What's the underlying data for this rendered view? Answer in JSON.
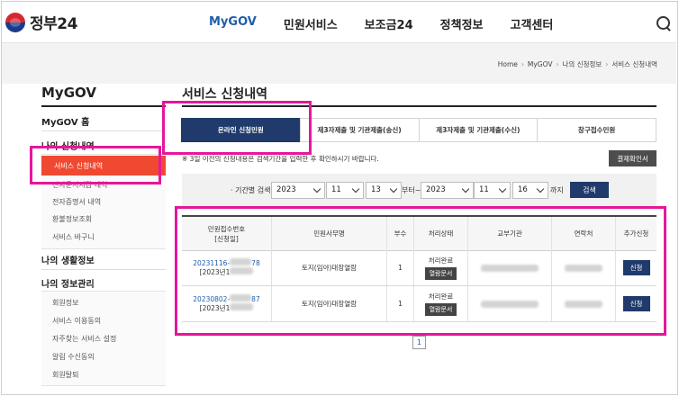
{
  "header": {
    "logo_text": "정부24",
    "nav": [
      "MyGOV",
      "민원서비스",
      "보조금24",
      "정책정보",
      "고객센터"
    ],
    "nav_active": "MyGOV"
  },
  "breadcrumb": [
    "Home",
    "MyGOV",
    "나의 신청정보",
    "서비스 신청내역"
  ],
  "sidebar": {
    "title": "MyGOV",
    "home": "MyGOV 홈",
    "sec_apply": "나의 신청내역",
    "apply_items": [
      "서비스 신청내역",
      "전자문서지갑 내역",
      "전자증명서 내역",
      "환불정보조회",
      "서비스 바구니"
    ],
    "sec_life": "나의 생활정보",
    "sec_info": "나의 정보관리",
    "info_items": [
      "회원정보",
      "서비스 이용동의",
      "자주찾는 서비스 설정",
      "알림 수신동의",
      "회원탈퇴"
    ]
  },
  "main": {
    "title": "서비스 신청내역",
    "tabs": [
      "온라인 신청민원",
      "제3자제출 및 기관제출(송신)",
      "제3자제출 및 기관제출(수신)",
      "창구접수민원"
    ],
    "notice": "※ 3일 이전의 신청내용은 검색기간을 입력한 후 확인하시기 바랍니다.",
    "receipt_button": "결제확인서",
    "filter": {
      "label": "· 기간별 검색",
      "from_year": "2023",
      "from_month": "11",
      "from_day": "13",
      "from_suffix": "부터~",
      "to_year": "2023",
      "to_month": "11",
      "to_day": "16",
      "to_suffix": "까지",
      "search_button": "검색"
    },
    "table": {
      "headers": [
        "민원접수번호\n[신청일]",
        "민원사무명",
        "부수",
        "처리상태",
        "교부기관",
        "연락처",
        "추가신청"
      ],
      "rows": [
        {
          "no_prefix": "20231116-",
          "no_suffix": "78",
          "date": "[2023년1",
          "name": "토지(임야)대장열람",
          "count": "1",
          "status": "처리완료",
          "doc": "열람문서",
          "apply": "신청"
        },
        {
          "no_prefix": "20230802-",
          "no_suffix": "87",
          "date": "[2023년1",
          "name": "토지(임야)대장열람",
          "count": "1",
          "status": "처리완료",
          "doc": "열람문서",
          "apply": "신청"
        }
      ]
    },
    "page": "1"
  },
  "highlight_color": "#e6169b"
}
